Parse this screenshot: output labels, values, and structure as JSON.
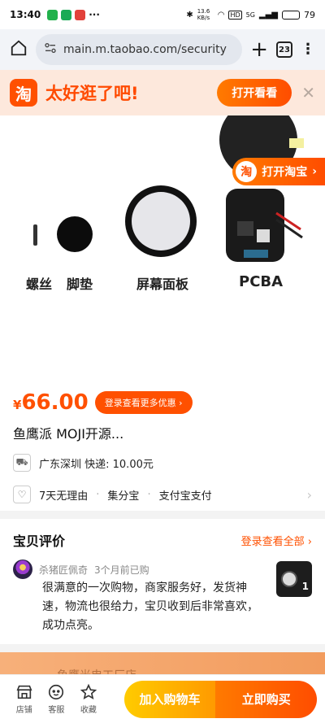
{
  "status_bar": {
    "time": "13:40",
    "battery": "79",
    "network": "5G",
    "speed": "13.6 KB/s",
    "hd": "HD",
    "battery_level": 0.79
  },
  "browser": {
    "url": "main.m.taobao.com/security",
    "tab_count": "23"
  },
  "promo": {
    "logo_char": "淘",
    "text": "太好逛了吧!",
    "open_button": "打开看看"
  },
  "product_image": {
    "open_taobao": "打开淘宝",
    "labels": [
      "螺丝",
      "脚垫",
      "屏幕面板",
      "PCBA"
    ]
  },
  "price": {
    "currency": "¥",
    "amount": "66.00",
    "coupon": "登录查看更多优惠"
  },
  "product_title": "鱼鹰派 MOJI开源...",
  "shipping": {
    "text": "广东深圳 快递: 10.00元"
  },
  "services": {
    "items": [
      "7天无理由",
      "集分宝",
      "支付宝支付"
    ]
  },
  "reviews": {
    "heading": "宝贝评价",
    "view_all": "登录查看全部",
    "reviewer": "杀猪匠佩奇",
    "time": "3个月前已购",
    "text": "很满意的一次购物，商家服务好，发货神速，物流也很给力，宝贝收到后非常喜欢，成功点亮。",
    "image_count": "1"
  },
  "shop_strip": {
    "text": "鱼鹰光电工厂店"
  },
  "bottom_bar": {
    "store": "店铺",
    "service": "客服",
    "favorite": "收藏",
    "add_to_cart": "加入购物车",
    "buy_now": "立即购买"
  },
  "colors": {
    "brand": "#ff5000",
    "cart": "#ff9a00"
  }
}
